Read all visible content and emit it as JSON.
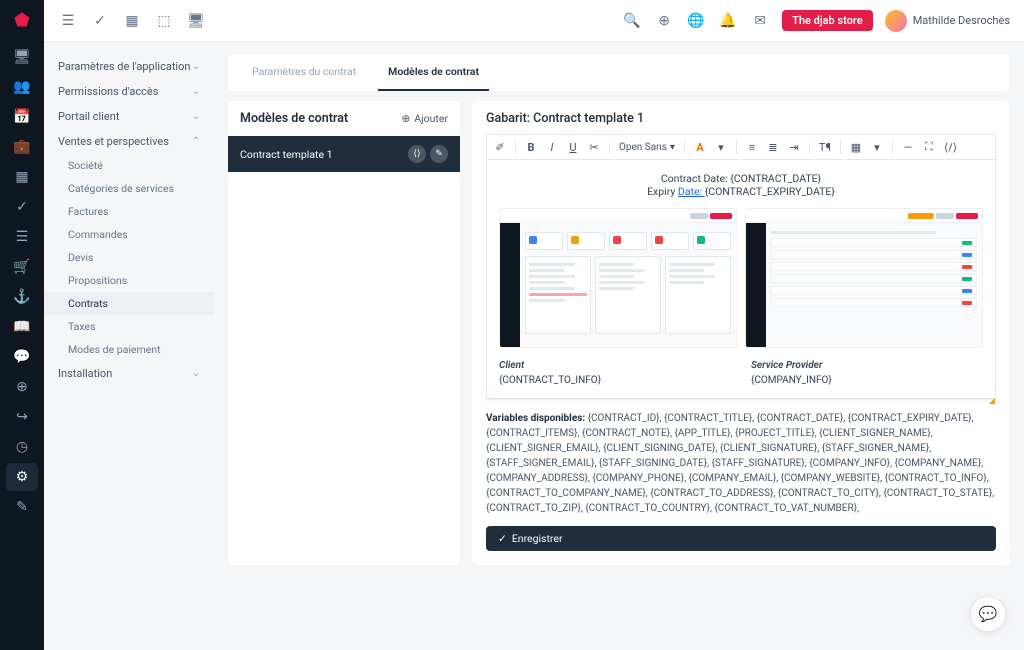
{
  "topbar": {
    "store_badge": "The djab store",
    "user_name": "Mathilde Desroches"
  },
  "nav": {
    "groups": {
      "app_params": "Paramètres de l'application",
      "permissions": "Permissions d'accès",
      "portal": "Portail client",
      "ventes": "Ventes et perspectives",
      "installation": "Installation"
    },
    "ventes_items": {
      "societe": "Société",
      "categories": "Catégories de services",
      "factures": "Factures",
      "commandes": "Commandes",
      "devis": "Devis",
      "propositions": "Propositions",
      "contrats": "Contrats",
      "taxes": "Taxes",
      "paiement": "Modes de paiement"
    }
  },
  "tabs": {
    "params": "Paramètres du contrat",
    "models": "Modèles de contrat"
  },
  "list": {
    "title": "Modèles de contrat",
    "add": "Ajouter",
    "item1": "Contract template 1"
  },
  "editor": {
    "title": "Gabarit: Contract template 1",
    "font": "Open Sans",
    "date_line": "Contract Date: {CONTRACT_DATE}",
    "expiry_prefix": "Expiry ",
    "expiry_link": "Date: ",
    "expiry_suffix": "{CONTRACT_EXPIRY_DATE}",
    "client_label": "Client",
    "provider_label": "Service Provider",
    "client_var": "{CONTRACT_TO_INFO}",
    "provider_var": "{COMPANY_INFO}"
  },
  "vars": {
    "label": "Variables disponibles:",
    "list": " {CONTRACT_ID}, {CONTRACT_TITLE}, {CONTRACT_DATE}, {CONTRACT_EXPIRY_DATE}, {CONTRACT_ITEMS}, {CONTRACT_NOTE}, {APP_TITLE}, {PROJECT_TITLE}, {CLIENT_SIGNER_NAME}, {CLIENT_SIGNER_EMAIL}, {CLIENT_SIGNING_DATE}, {CLIENT_SIGNATURE}, {STAFF_SIGNER_NAME}, {STAFF_SIGNER_EMAIL}, {STAFF_SIGNING_DATE}, {STAFF_SIGNATURE}, {COMPANY_INFO}, {COMPANY_NAME}, {COMPANY_ADDRESS}, {COMPANY_PHONE}, {COMPANY_EMAIL}, {COMPANY_WEBSITE}, {CONTRACT_TO_INFO}, {CONTRACT_TO_COMPANY_NAME}, {CONTRACT_TO_ADDRESS}, {CONTRACT_TO_CITY}, {CONTRACT_TO_STATE}, {CONTRACT_TO_ZIP}, {CONTRACT_TO_COUNTRY}, {CONTRACT_TO_VAT_NUMBER},"
  },
  "save": "Enregistrer"
}
